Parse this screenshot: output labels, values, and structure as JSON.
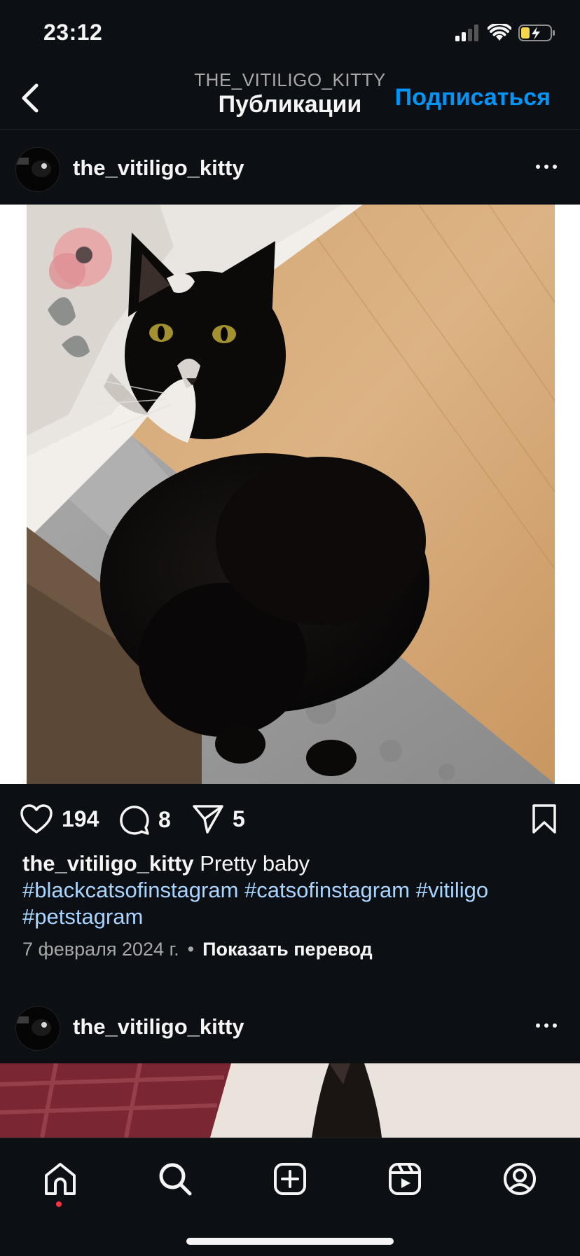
{
  "status_bar": {
    "time": "23:12"
  },
  "header": {
    "username": "THE_VITILIGO_KITTY",
    "title": "Публикации",
    "subscribe_label": "Подписаться"
  },
  "posts": [
    {
      "username": "the_vitiligo_kitty",
      "likes": "194",
      "comments": "8",
      "shares": "5",
      "caption_username": "the_vitiligo_kitty",
      "caption_text": "Pretty baby",
      "hashtags": [
        "#blackcatsofinstagram",
        "#catsofinstagram",
        "#vitiligo",
        "#petstagram"
      ],
      "date": "7 февраля 2024 г.",
      "separator": "•",
      "translate_label": "Показать перевод"
    },
    {
      "username": "the_vitiligo_kitty"
    }
  ],
  "colors": {
    "background": "#0c1014",
    "accent": "#0095f6",
    "hashtag": "#a8d4ff",
    "notification_dot": "#ff3040"
  },
  "bottom_nav": {
    "icons": [
      "home-icon",
      "search-icon",
      "create-icon",
      "reels-icon",
      "profile-icon"
    ]
  }
}
